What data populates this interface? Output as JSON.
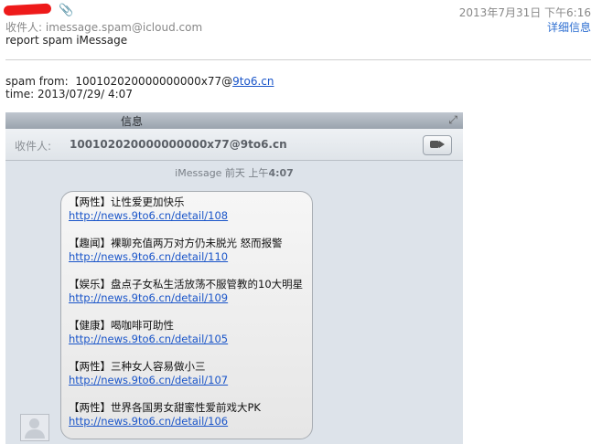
{
  "email": {
    "to_label": "收件人:",
    "to_address": "imessage.spam@icloud.com",
    "subject": "report spam iMessage",
    "date": "2013年7月31日 下午6:16",
    "details_link": "详细信息",
    "body": {
      "spam_from_label": "spam from:",
      "spam_from_number": "100102020000000000x77@",
      "spam_from_domain": "9to6.cn",
      "time_label": "time:",
      "time_value": "2013/07/29/ 4:07"
    }
  },
  "screenshot": {
    "title": "信息",
    "to_label": "收件人:",
    "to_value": "100102020000000000x77@9to6.cn",
    "timestamp_prefix": "iMessage 前天 上午",
    "timestamp_time": "4:07",
    "items": [
      {
        "head": "【两性】让性爱更加快乐",
        "link": "http://news.9to6.cn/detail/108"
      },
      {
        "head": "【趣闻】裸聊充值两万对方仍未脱光 怒而报警",
        "link": "http://news.9to6.cn/detail/110"
      },
      {
        "head": "【娱乐】盘点子女私生活放荡不服管教的10大明星",
        "link": "http://news.9to6.cn/detail/109"
      },
      {
        "head": "【健康】喝咖啡可助性",
        "link": "http://news.9to6.cn/detail/105"
      },
      {
        "head": "【两性】三种女人容易做小三",
        "link": "http://news.9to6.cn/detail/107"
      },
      {
        "head": "【两性】世界各国男女甜蜜性爱前戏大PK",
        "link": "http://news.9to6.cn/detail/106"
      }
    ]
  },
  "colors": {
    "link": "#1a55c9",
    "redaction": "#ee1a1a"
  }
}
